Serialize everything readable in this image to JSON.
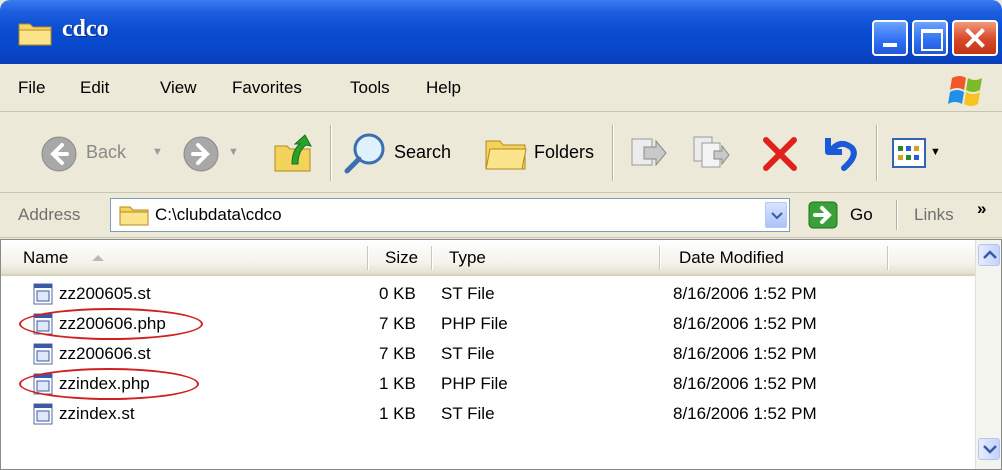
{
  "window": {
    "title": "cdco"
  },
  "menu": {
    "items": [
      "File",
      "Edit",
      "View",
      "Favorites",
      "Tools",
      "Help"
    ]
  },
  "toolbar": {
    "back_label": "Back",
    "search_label": "Search",
    "folders_label": "Folders"
  },
  "address": {
    "label": "Address",
    "value": "C:\\clubdata\\cdco",
    "go_label": "Go",
    "links_label": "Links",
    "more": "»"
  },
  "columns": {
    "name": "Name",
    "size": "Size",
    "type": "Type",
    "date": "Date Modified"
  },
  "files": [
    {
      "name": "zz200605.st",
      "size": "0 KB",
      "type": "ST File",
      "date": "8/16/2006 1:52 PM",
      "highlighted": false
    },
    {
      "name": "zz200606.php",
      "size": "7 KB",
      "type": "PHP File",
      "date": "8/16/2006 1:52 PM",
      "highlighted": true
    },
    {
      "name": "zz200606.st",
      "size": "7 KB",
      "type": "ST File",
      "date": "8/16/2006 1:52 PM",
      "highlighted": false
    },
    {
      "name": "zzindex.php",
      "size": "1 KB",
      "type": "PHP File",
      "date": "8/16/2006 1:52 PM",
      "highlighted": true
    },
    {
      "name": "zzindex.st",
      "size": "1 KB",
      "type": "ST File",
      "date": "8/16/2006 1:52 PM",
      "highlighted": false
    }
  ],
  "colors": {
    "titlebar": "#0a4ed2",
    "highlight_circle": "#d02020",
    "delete_x": "#e0201a",
    "window_bg": "#ece9d8"
  },
  "icons": [
    "folder-icon",
    "minimize-icon",
    "maximize-icon",
    "close-icon",
    "windows-logo-icon",
    "back-arrow-icon",
    "forward-arrow-icon",
    "up-folder-icon",
    "search-icon",
    "folders-icon",
    "move-to-icon",
    "copy-to-icon",
    "delete-icon",
    "undo-icon",
    "views-icon",
    "go-arrow-icon",
    "file-icon",
    "sort-up-icon",
    "scroll-up-icon",
    "scroll-down-icon"
  ]
}
